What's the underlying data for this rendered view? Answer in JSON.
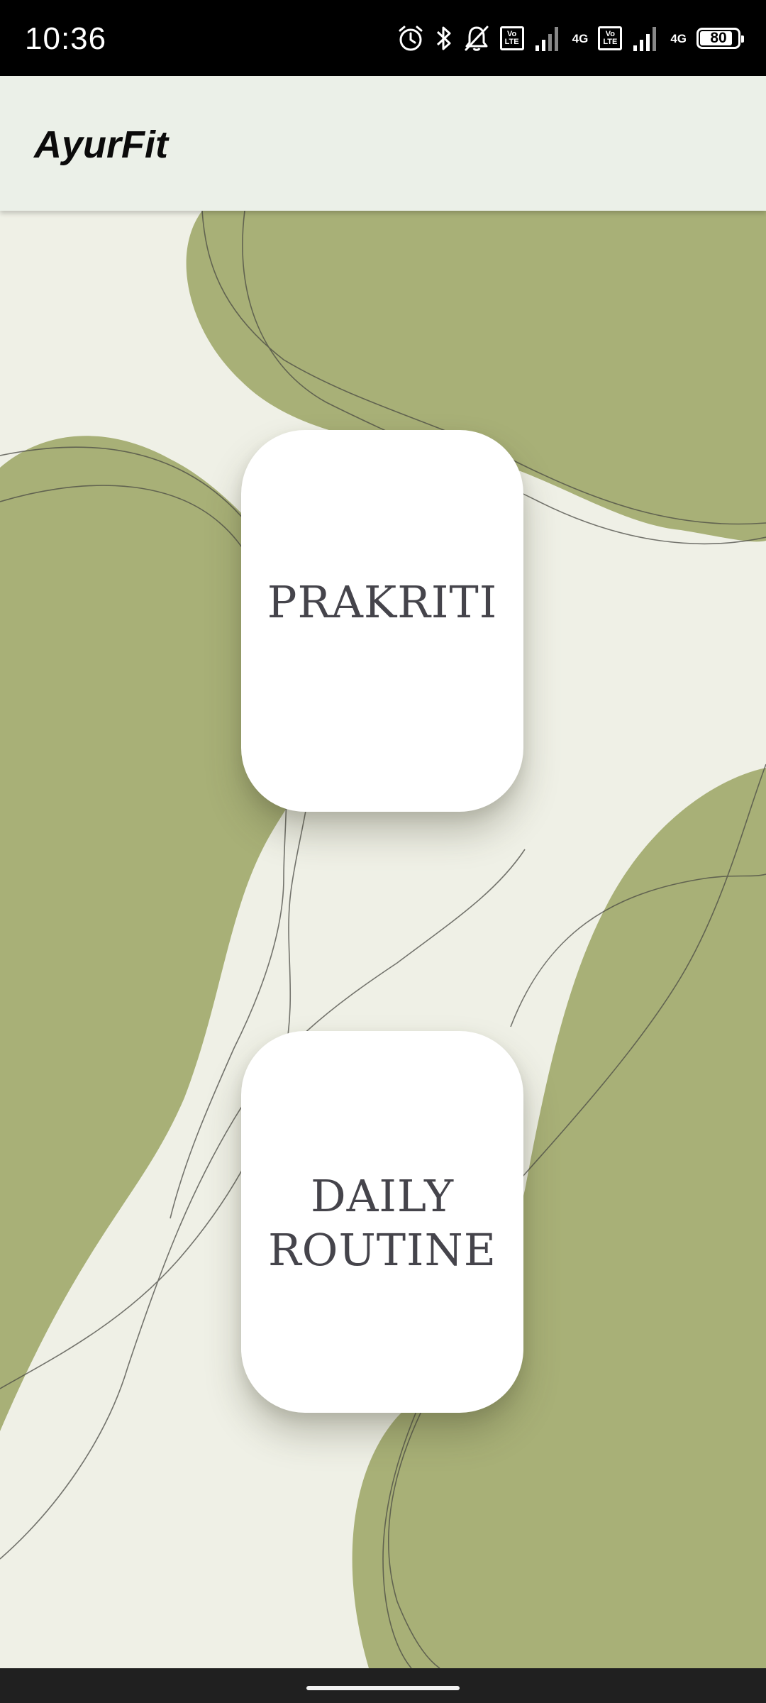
{
  "status_bar": {
    "time": "10:36",
    "battery_level": "80",
    "network_type_1": "4G",
    "network_type_2": "4G",
    "volte_label_top": "Vo",
    "volte_label_bottom": "LTE",
    "icons": [
      "alarm-icon",
      "bluetooth-icon",
      "bell-off-icon",
      "volte-icon",
      "signal-icon",
      "volte-icon",
      "signal-icon",
      "battery-icon"
    ]
  },
  "app_bar": {
    "title": "AyurFit"
  },
  "cards": {
    "prakriti": "PRAKRITI",
    "daily_routine": "DAILY ROUTINE"
  },
  "colors": {
    "background": "#eff0e6",
    "blob": "#a8b077",
    "card": "#ffffff",
    "card_text": "#45444b",
    "app_bar": "#ebf0e8"
  }
}
